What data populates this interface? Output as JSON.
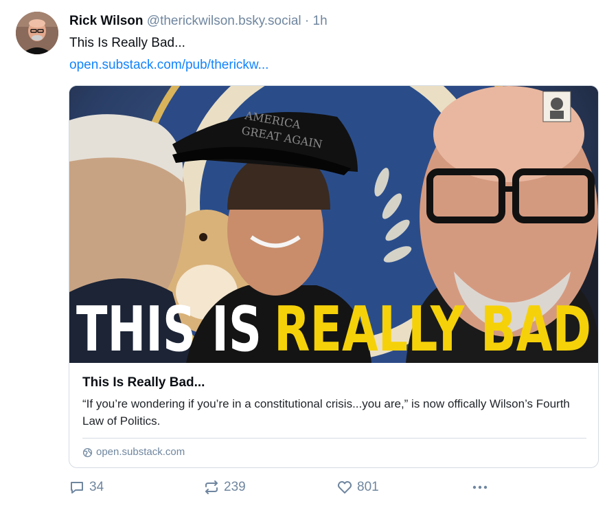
{
  "post": {
    "author": {
      "name": "Rick Wilson",
      "handle": "@therickwilson.bsky.social",
      "separator": "·",
      "time": "1h"
    },
    "text": "This Is Really Bad...",
    "link": "open.substack.com/pub/therickw..."
  },
  "embed": {
    "image_text": {
      "word1": "THIS IS",
      "word2": "REALLY BAD"
    },
    "title": "This Is Really Bad...",
    "description": "“If you’re wondering if you’re in a constitutional crisis...you are,” is now offically Wilson’s Fourth Law of Politics.",
    "domain": "open.substack.com"
  },
  "actions": {
    "replies": "34",
    "reposts": "239",
    "likes": "801"
  },
  "colors": {
    "link": "#1083fe",
    "muted": "#6f869f",
    "headline_yellow": "#f5d10a"
  },
  "icons": [
    "avatar",
    "globe-icon",
    "reply-icon",
    "repost-icon",
    "heart-icon",
    "more-icon"
  ]
}
